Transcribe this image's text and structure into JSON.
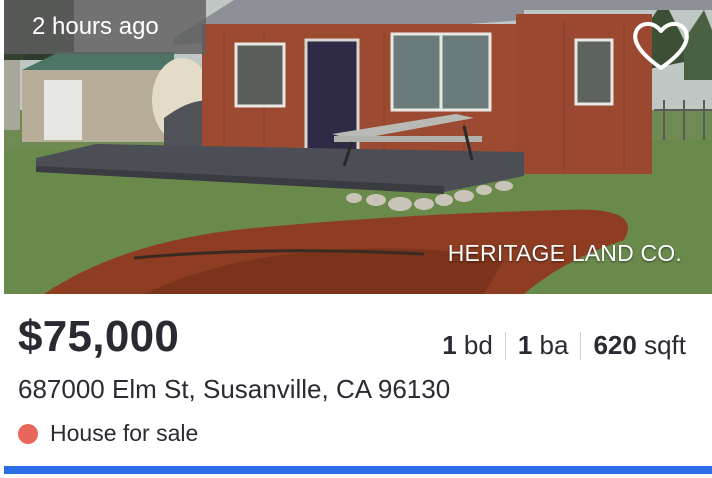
{
  "listing": {
    "time_ago": "2 hours ago",
    "watermark": "HERITAGE LAND CO.",
    "price": "$75,000",
    "beds_value": "1",
    "beds_unit": "bd",
    "baths_value": "1",
    "baths_unit": "ba",
    "sqft_value": "620",
    "sqft_unit": "sqft",
    "address": "687000 Elm St, Susanville, CA 96130",
    "status_text": "House for sale"
  },
  "icons": {
    "favorite": "heart-outline-icon",
    "status": "status-dot"
  },
  "colors": {
    "status_dot": "#e9675a",
    "accent_bar": "#2b6de8",
    "text": "#2a2a33"
  }
}
